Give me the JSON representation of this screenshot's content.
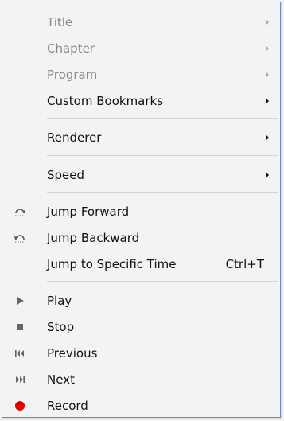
{
  "menu": {
    "items": [
      {
        "label": "Title",
        "enabled": false,
        "submenu": true
      },
      {
        "label": "Chapter",
        "enabled": false,
        "submenu": true
      },
      {
        "label": "Program",
        "enabled": false,
        "submenu": true
      },
      {
        "label": "Custom Bookmarks",
        "enabled": true,
        "submenu": true
      },
      {
        "label": "Renderer",
        "enabled": true,
        "submenu": true
      },
      {
        "label": "Speed",
        "enabled": true,
        "submenu": true
      },
      {
        "label": "Jump Forward",
        "enabled": true,
        "icon": "jump-forward-icon"
      },
      {
        "label": "Jump Backward",
        "enabled": true,
        "icon": "jump-backward-icon"
      },
      {
        "label": "Jump to Specific Time",
        "enabled": true,
        "shortcut": "Ctrl+T"
      },
      {
        "label": "Play",
        "enabled": true,
        "icon": "play-icon"
      },
      {
        "label": "Stop",
        "enabled": true,
        "icon": "stop-icon"
      },
      {
        "label": "Previous",
        "enabled": true,
        "icon": "previous-icon"
      },
      {
        "label": "Next",
        "enabled": true,
        "icon": "next-icon"
      },
      {
        "label": "Record",
        "enabled": true,
        "icon": "record-icon"
      }
    ]
  },
  "colors": {
    "record": "#e00000",
    "icon_gray": "#555555",
    "disabled_text": "#8b8b8b",
    "border": "#6f8fc4"
  }
}
